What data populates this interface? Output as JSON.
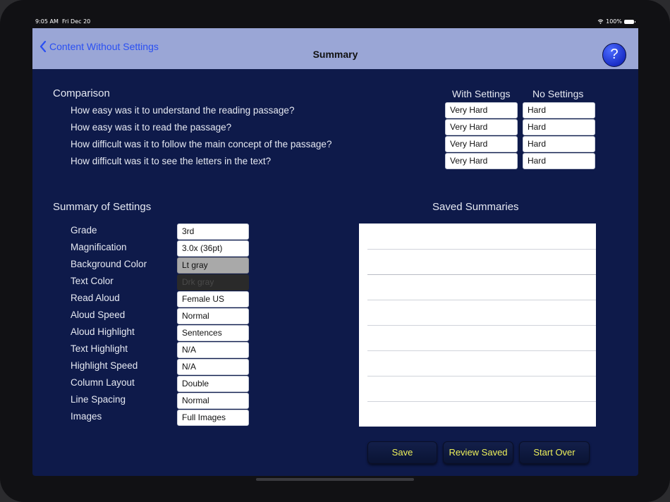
{
  "status_bar": {
    "time": "9:05 AM",
    "date": "Fri Dec 20",
    "battery": "100%"
  },
  "nav": {
    "back_label": "Content Without Settings",
    "title": "Summary",
    "help_label": "?"
  },
  "comparison": {
    "title": "Comparison",
    "col_with": "With Settings",
    "col_without": "No Settings",
    "rows": [
      {
        "question": "How easy was it to understand the reading passage?",
        "with": "Very Hard",
        "without": "Hard"
      },
      {
        "question": "How easy was it to read the passage?",
        "with": "Very Hard",
        "without": "Hard"
      },
      {
        "question": "How difficult was it to follow the main concept of the passage?",
        "with": "Very Hard",
        "without": "Hard"
      },
      {
        "question": "How difficult was it to see the letters in the text?",
        "with": "Very Hard",
        "without": "Hard"
      }
    ]
  },
  "settings": {
    "title": "Summary of Settings",
    "rows": [
      {
        "label": "Grade",
        "value": "3rd"
      },
      {
        "label": "Magnification",
        "value": "3.0x (36pt)"
      },
      {
        "label": "Background Color",
        "value": "Lt gray"
      },
      {
        "label": "Text Color",
        "value": "Drk gray"
      },
      {
        "label": "Read Aloud",
        "value": "Female US"
      },
      {
        "label": "Aloud Speed",
        "value": "Normal"
      },
      {
        "label": "Aloud Highlight",
        "value": "Sentences"
      },
      {
        "label": "Text Highlight",
        "value": "N/A"
      },
      {
        "label": "Highlight Speed",
        "value": "N/A"
      },
      {
        "label": "Column Layout",
        "value": "Double"
      },
      {
        "label": "Line Spacing",
        "value": "Normal"
      },
      {
        "label": "Images",
        "value": "Full Images"
      }
    ],
    "background_swatch": "#a9a9a9",
    "text_color_swatch": "#2a2a2a"
  },
  "saved": {
    "title": "Saved Summaries"
  },
  "buttons": {
    "save": "Save",
    "review": "Review Saved",
    "start_over": "Start Over"
  },
  "colors": {
    "screen_bg": "#0e1a4a",
    "nav_bg": "#9aa6d6",
    "link": "#2a4ff2",
    "button_text": "#eef05a"
  }
}
